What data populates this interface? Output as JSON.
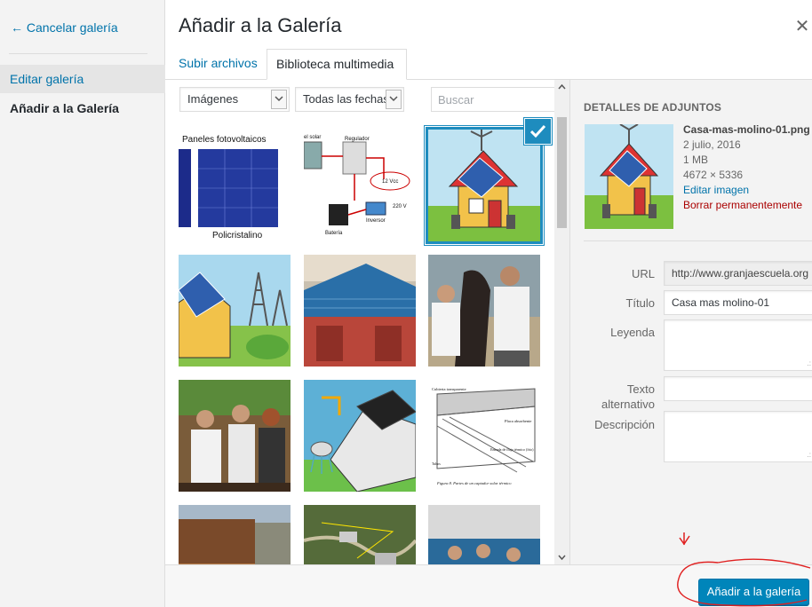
{
  "menu": {
    "cancel_label": "← Cancelar galería",
    "edit_gallery": "Editar galería",
    "add_to_gallery": "Añadir a la Galería"
  },
  "frame": {
    "title": "Añadir a la Galería",
    "close_icon": "close-icon"
  },
  "tabs": {
    "upload": "Subir archivos",
    "library": "Biblioteca multimedia"
  },
  "filters": {
    "type_selected": "Imágenes",
    "date_selected": "Todas las fechas",
    "search_placeholder": "Buscar"
  },
  "grid": {
    "thumb1_caption_top": "Paneles fotovoltaicos",
    "thumb1_caption_bottom": "Policristalino",
    "thumb2_labels": [
      "Regulador",
      "12 Vcc",
      "220 V",
      "Inversor",
      "Batería",
      "el solar"
    ],
    "thumb9_labels": [
      "Cubierta transparente",
      "Placa absorbente",
      "Entrada de flujo térmico (frío)",
      "Tubos",
      "Figura 8. Partes de un captador solar térmico"
    ],
    "selected_index": 2
  },
  "details": {
    "section_title": "Detalles de adjuntos",
    "filename": "Casa-mas-molino-01.png",
    "date": "2 julio, 2016",
    "size": "1 MB",
    "dimensions": "4672 × 5336",
    "edit_link": "Editar imagen",
    "delete_link": "Borrar permanentemente",
    "url_label": "URL",
    "url_value": "http://www.granjaescuela.org",
    "title_label": "Título",
    "title_value": "Casa mas molino-01",
    "caption_label": "Leyenda",
    "alt_label_1": "Texto",
    "alt_label_2": "alternativo",
    "description_label": "Descripción"
  },
  "toolbar": {
    "primary_label": "Añadir a la galería"
  },
  "colors": {
    "accent": "#0085ba",
    "link": "#0073aa",
    "danger": "#a00000",
    "annotation": "#e02020"
  }
}
